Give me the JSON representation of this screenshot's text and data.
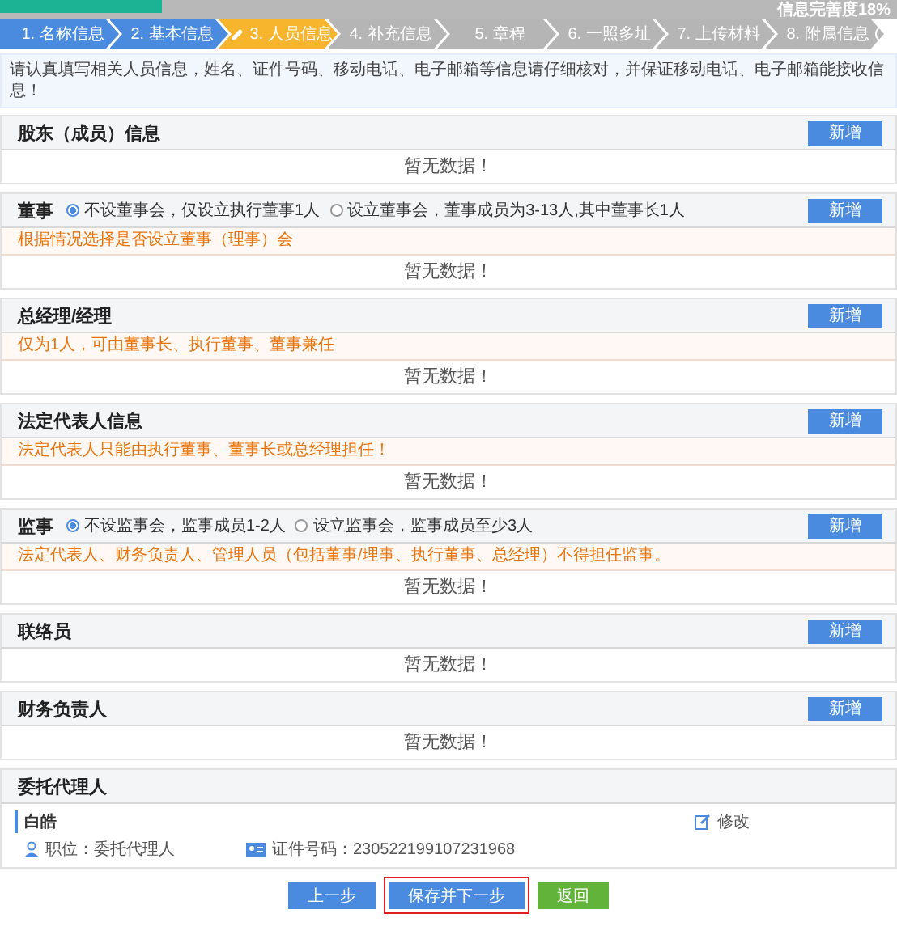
{
  "progress": {
    "label": "信息完善度18%",
    "level": 0.18
  },
  "steps": [
    {
      "label": "1. 名称信息",
      "done": true,
      "selected": false
    },
    {
      "label": "2. 基本信息",
      "done": true,
      "selected": false
    },
    {
      "label": "3. 人员信息",
      "done": false,
      "selected": true
    },
    {
      "label": "4. 补充信息",
      "done": false,
      "selected": false
    },
    {
      "label": "5. 章程",
      "done": false,
      "selected": false
    },
    {
      "label": "6. 一照多址",
      "done": false,
      "selected": false
    },
    {
      "label": "7. 上传材料",
      "done": false,
      "selected": false
    },
    {
      "label": "8. 附属信息",
      "done": false,
      "selected": false
    }
  ],
  "notice": "请认真填写相关人员信息，姓名、证件号码、移动电话、电子邮箱等信息请仔细核对，并保证移动电话、电子邮箱能接收信息！",
  "sections": [
    {
      "title": "股东（成员）信息",
      "add_button": "新增",
      "empty": "暂无数据！"
    },
    {
      "title": "董事",
      "options": [
        {
          "label": "不设董事会，仅设立执行董事1人",
          "selected": true
        },
        {
          "label": "设立董事会，董事成员为3-13人,其中董事长1人",
          "selected": false
        }
      ],
      "hint": "根据情况选择是否设立董事（理事）会",
      "add_button": "新增",
      "empty": "暂无数据！"
    },
    {
      "title": "总经理/经理",
      "hint": "仅为1人，可由董事长、执行董事、董事兼任",
      "add_button": "新增",
      "empty": "暂无数据！"
    },
    {
      "title": "法定代表人信息",
      "hint": "法定代表人只能由执行董事、董事长或总经理担任！",
      "add_button": "新增",
      "empty": "暂无数据！"
    },
    {
      "title": "监事",
      "options": [
        {
          "label": "不设监事会，监事成员1-2人",
          "selected": true
        },
        {
          "label": "设立监事会，监事成员至少3人",
          "selected": false
        }
      ],
      "hint": "法定代表人、财务负责人、管理人员（包括董事/理事、执行董事、总经理）不得担任监事。",
      "add_button": "新增",
      "empty": "暂无数据！"
    },
    {
      "title": "联络员",
      "add_button": "新增",
      "empty": "暂无数据！"
    },
    {
      "title": "财务负责人",
      "add_button": "新增",
      "empty": "暂无数据！"
    },
    {
      "title": "委托代理人",
      "person": {
        "name": "白皓",
        "role": "职位：委托代理人",
        "id_number": "证件号码：230522199107231968",
        "edit": "修改"
      }
    }
  ],
  "actions": [
    {
      "label": "上一步",
      "kind": "primary",
      "highlighted": false
    },
    {
      "label": "保存并下一步",
      "kind": "primary",
      "highlighted": true
    },
    {
      "label": "返回",
      "kind": "success",
      "highlighted": false
    }
  ]
}
